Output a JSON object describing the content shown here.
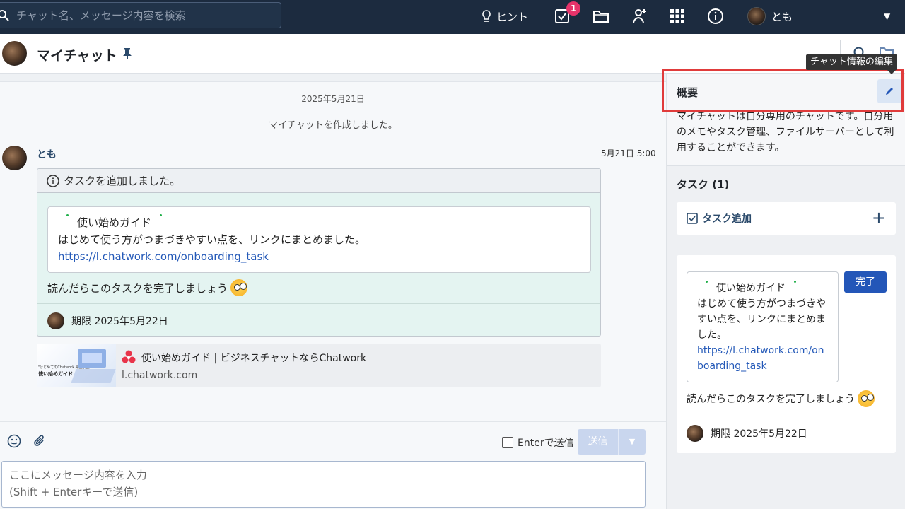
{
  "topbar": {
    "search_placeholder": "チャット名、メッセージ内容を検索",
    "hint_label": "ヒント",
    "task_badge": "1",
    "user_name": "とも"
  },
  "header": {
    "room_title": "マイチャット"
  },
  "timeline": {
    "date_separator": "2025年5月21日",
    "system_message": "マイチャットを作成しました。",
    "message": {
      "sender": "とも",
      "time": "5月21日 5:00",
      "task_header": "タスクを追加しました。",
      "quote_title": "使い始めガイド",
      "quote_body": "はじめて使う方がつまづきやすい点を、リンクにまとめました。",
      "quote_link": "https://l.chatwork.com/onboarding_task",
      "task_text": "読んだらこのタスクを完了しましょう",
      "deadline": "期限 2025年5月22日"
    },
    "link_preview": {
      "thumb_small": "\"はじめてのChatwork 完全解説\"",
      "thumb_title": "使い始めガイド",
      "title": "使い始めガイド | ビジネスチャットならChatwork",
      "domain": "l.chatwork.com"
    }
  },
  "composer": {
    "enter_send_label": "Enterで送信",
    "send_label": "送信",
    "input_placeholder": "ここにメッセージ内容を入力\n(Shift + Enterキーで送信)"
  },
  "right_panel": {
    "tooltip": "チャット情報の編集",
    "summary_title": "概要",
    "summary_text": "マイチャットは自分専用のチャットです。自分用のメモやタスク管理、ファイルサーバーとして利用することができます。",
    "task_section_title": "タスク (1)",
    "add_task_label": "タスク追加",
    "task": {
      "quote_title": "使い始めガイド",
      "quote_body": "はじめて使う方がつまづきやすい点を、リンクにまとめました。",
      "quote_link": "https://l.chatwork.com/onboarding_task",
      "done_label": "完了",
      "task_text": "読んだらこのタスクを完了しましょう",
      "deadline": "期限 2025年5月22日"
    }
  },
  "icons": {
    "search": "search-icon",
    "hint": "lightbulb-icon",
    "task": "task-check-icon",
    "folder": "folder-icon",
    "contact": "add-contact-icon",
    "apps": "grid-icon",
    "info": "info-icon",
    "pin": "pin-icon",
    "edit": "pencil-icon",
    "emoji": "smiley-icon",
    "attach": "paperclip-icon"
  },
  "colors": {
    "topbar_bg": "#1c2b3f",
    "badge": "#e6336a",
    "link": "#2459b8",
    "primary_button": "#2356b8",
    "highlight": "#e03b3b"
  }
}
